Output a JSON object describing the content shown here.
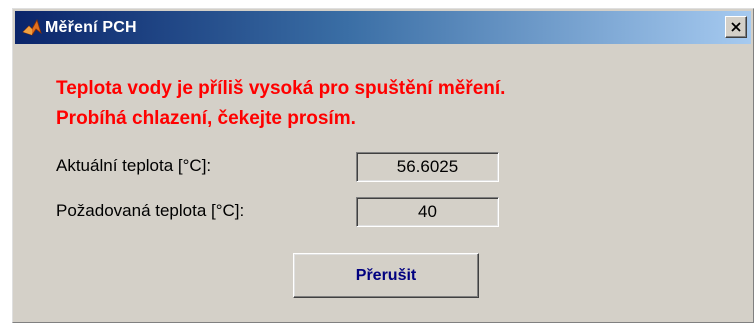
{
  "window": {
    "title": "Měření PCH",
    "close_label": "×"
  },
  "message": {
    "line1": "Teplota vody je příliš vysoká pro spuštění měření.",
    "line2": "Probíhá chlazení, čekejte prosím."
  },
  "fields": [
    {
      "label": "Aktuální teplota [°C]:",
      "value": "56.6025"
    },
    {
      "label": "Požadovaná teplota [°C]:",
      "value": "40"
    }
  ],
  "button": {
    "label": "Přerušit"
  },
  "colors": {
    "message": "#ff0000",
    "button_text": "#000080",
    "titlebar_start": "#0a246a",
    "titlebar_end": "#a6caf0",
    "dialog_bg": "#d4d0c8"
  }
}
